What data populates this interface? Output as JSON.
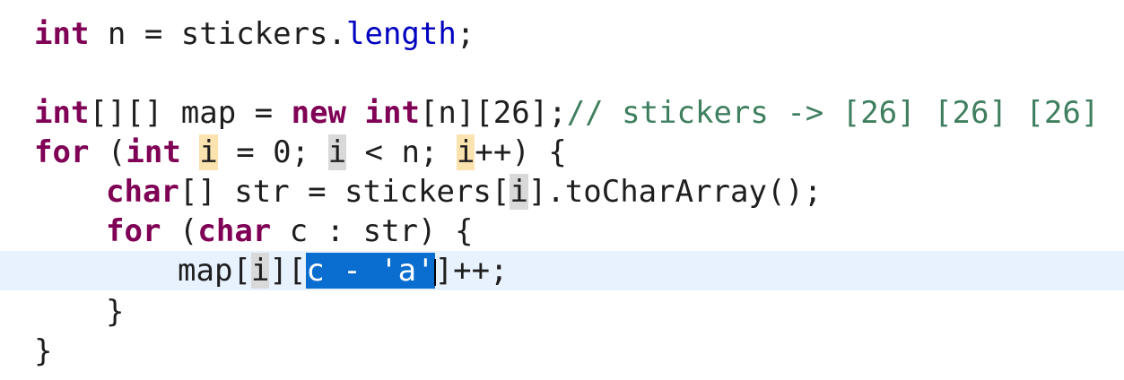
{
  "editor": {
    "language": "java",
    "lines": [
      {
        "indent": 0,
        "tokens": [
          [
            "int",
            "kw"
          ],
          [
            " n = stickers.",
            ""
          ],
          [
            "length",
            "field"
          ],
          [
            ";",
            ""
          ]
        ]
      },
      {
        "indent": 0,
        "tokens": []
      },
      {
        "indent": 0,
        "tokens": [
          [
            "int",
            "kw"
          ],
          [
            "[][] map = ",
            ""
          ],
          [
            "new",
            "kw"
          ],
          [
            " ",
            ""
          ],
          [
            "int",
            "kw"
          ],
          [
            "[n][26];",
            ""
          ],
          [
            "// stickers -> [26] [26] [26]",
            "comment"
          ]
        ]
      },
      {
        "indent": 0,
        "tokens": [
          [
            "for",
            "kw"
          ],
          [
            " (",
            ""
          ],
          [
            "int",
            "kw"
          ],
          [
            " ",
            ""
          ],
          [
            "i",
            "occ-write"
          ],
          [
            " = 0; ",
            ""
          ],
          [
            "i",
            "occ-read"
          ],
          [
            " < n; ",
            ""
          ],
          [
            "i",
            "occ-write"
          ],
          [
            "++) {",
            ""
          ]
        ]
      },
      {
        "indent": 1,
        "tokens": [
          [
            "char",
            "kw"
          ],
          [
            "[] str = stickers[",
            ""
          ],
          [
            "i",
            "occ-read"
          ],
          [
            "].toCharArray();",
            ""
          ]
        ]
      },
      {
        "indent": 1,
        "tokens": [
          [
            "for",
            "kw"
          ],
          [
            " (",
            ""
          ],
          [
            "char",
            "kw"
          ],
          [
            " c : str) {",
            ""
          ]
        ]
      },
      {
        "indent": 2,
        "current": true,
        "tokens": [
          [
            "map[",
            ""
          ],
          [
            "i",
            "occ-read"
          ],
          [
            "][",
            ""
          ],
          [
            "c - 'a'",
            "sel"
          ],
          [
            "]++;",
            ""
          ]
        ]
      },
      {
        "indent": 1,
        "tokens": [
          [
            "}",
            ""
          ]
        ]
      },
      {
        "indent": 0,
        "tokens": [
          [
            "}",
            ""
          ]
        ]
      }
    ]
  },
  "colors": {
    "keyword": "#7f0055",
    "field": "#0000c0",
    "comment": "#3f7f5f",
    "selection": "#0a6ed1",
    "current_line": "#e8f2fe",
    "occurrence_write": "#fbe3b0",
    "occurrence_read": "#d9d9d9"
  }
}
